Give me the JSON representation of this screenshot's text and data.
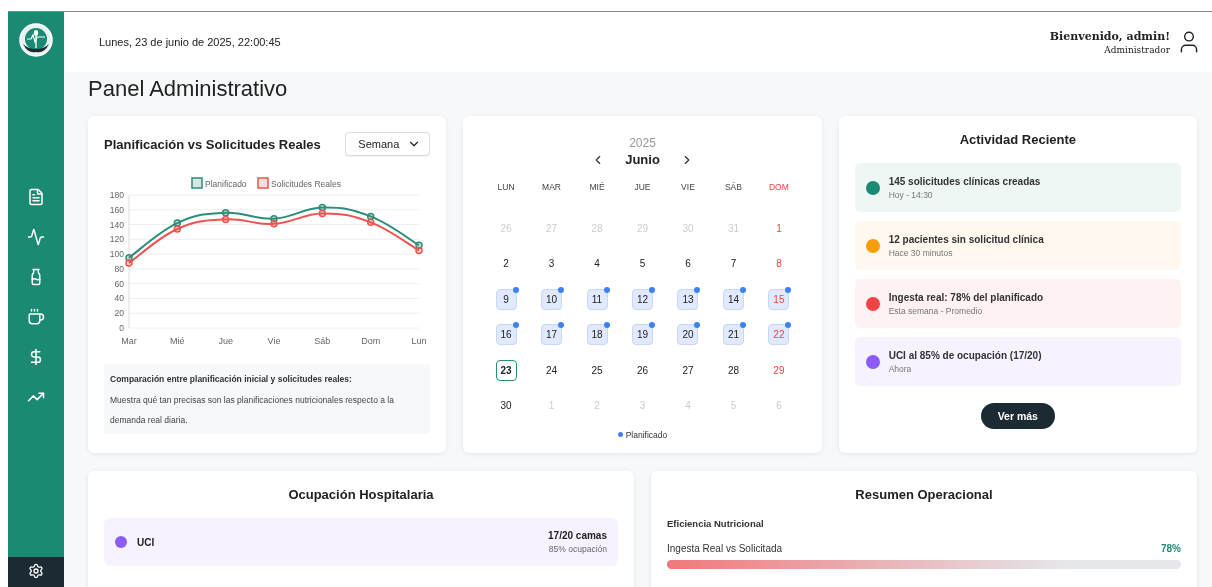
{
  "header": {
    "datetime": "Lunes, 23 de junio de 2025, 22:00:45",
    "greeting": "Bienvenido, admin!",
    "role": "Administrador"
  },
  "page_title": "Panel Administrativo",
  "planning_card": {
    "title": "Planificación vs Solicitudes Reales",
    "period": "Semana",
    "chart_data": {
      "type": "line",
      "grid": true,
      "legend": "top",
      "categories": [
        "Mar",
        "Mié",
        "Jue",
        "Vie",
        "Sáb",
        "Dom",
        "Lun"
      ],
      "ylim": [
        0,
        180
      ],
      "yticks": [
        0,
        20,
        40,
        60,
        80,
        100,
        120,
        140,
        160,
        180
      ],
      "series": [
        {
          "name": "Planificado",
          "color": "#2a8f78",
          "marker": "circle",
          "values": [
            95,
            142,
            156,
            148,
            163,
            151,
            112
          ]
        },
        {
          "name": "Solicitudes Reales",
          "color": "#ef5350",
          "marker": "circle",
          "values": [
            88,
            134,
            147,
            141,
            155,
            143,
            105
          ]
        }
      ]
    },
    "note_title": "Comparación entre planificación inicial y solicitudes reales:",
    "note_text": "Muestra qué tan precisas son las planificaciones nutricionales respecto a la demanda real diaria."
  },
  "calendar": {
    "year": "2025",
    "month": "Junio",
    "weekdays": [
      {
        "label": "LUN",
        "sunday": false
      },
      {
        "label": "MAR",
        "sunday": false
      },
      {
        "label": "MIÉ",
        "sunday": false
      },
      {
        "label": "JUE",
        "sunday": false
      },
      {
        "label": "VIE",
        "sunday": false
      },
      {
        "label": "SÁB",
        "sunday": false
      },
      {
        "label": "DOM",
        "sunday": true
      }
    ],
    "days": [
      {
        "day": "26",
        "outside": true,
        "sunday": false,
        "planned": false,
        "today": false
      },
      {
        "day": "27",
        "outside": true,
        "sunday": false,
        "planned": false,
        "today": false
      },
      {
        "day": "28",
        "outside": true,
        "sunday": false,
        "planned": false,
        "today": false
      },
      {
        "day": "29",
        "outside": true,
        "sunday": false,
        "planned": false,
        "today": false
      },
      {
        "day": "30",
        "outside": true,
        "sunday": false,
        "planned": false,
        "today": false
      },
      {
        "day": "31",
        "outside": true,
        "sunday": false,
        "planned": false,
        "today": false
      },
      {
        "day": "1",
        "outside": false,
        "sunday": true,
        "planned": false,
        "today": false
      },
      {
        "day": "2",
        "outside": false,
        "sunday": false,
        "planned": false,
        "today": false
      },
      {
        "day": "3",
        "outside": false,
        "sunday": false,
        "planned": false,
        "today": false
      },
      {
        "day": "4",
        "outside": false,
        "sunday": false,
        "planned": false,
        "today": false
      },
      {
        "day": "5",
        "outside": false,
        "sunday": false,
        "planned": false,
        "today": false
      },
      {
        "day": "6",
        "outside": false,
        "sunday": false,
        "planned": false,
        "today": false
      },
      {
        "day": "7",
        "outside": false,
        "sunday": false,
        "planned": false,
        "today": false
      },
      {
        "day": "8",
        "outside": false,
        "sunday": true,
        "planned": false,
        "today": false
      },
      {
        "day": "9",
        "outside": false,
        "sunday": false,
        "planned": true,
        "today": false
      },
      {
        "day": "10",
        "outside": false,
        "sunday": false,
        "planned": true,
        "today": false
      },
      {
        "day": "11",
        "outside": false,
        "sunday": false,
        "planned": true,
        "today": false
      },
      {
        "day": "12",
        "outside": false,
        "sunday": false,
        "planned": true,
        "today": false
      },
      {
        "day": "13",
        "outside": false,
        "sunday": false,
        "planned": true,
        "today": false
      },
      {
        "day": "14",
        "outside": false,
        "sunday": false,
        "planned": true,
        "today": false
      },
      {
        "day": "15",
        "outside": false,
        "sunday": true,
        "planned": true,
        "today": false
      },
      {
        "day": "16",
        "outside": false,
        "sunday": false,
        "planned": true,
        "today": false
      },
      {
        "day": "17",
        "outside": false,
        "sunday": false,
        "planned": true,
        "today": false
      },
      {
        "day": "18",
        "outside": false,
        "sunday": false,
        "planned": true,
        "today": false
      },
      {
        "day": "19",
        "outside": false,
        "sunday": false,
        "planned": true,
        "today": false
      },
      {
        "day": "20",
        "outside": false,
        "sunday": false,
        "planned": true,
        "today": false
      },
      {
        "day": "21",
        "outside": false,
        "sunday": false,
        "planned": true,
        "today": false
      },
      {
        "day": "22",
        "outside": false,
        "sunday": true,
        "planned": true,
        "today": false
      },
      {
        "day": "23",
        "outside": false,
        "sunday": false,
        "planned": false,
        "today": true
      },
      {
        "day": "24",
        "outside": false,
        "sunday": false,
        "planned": false,
        "today": false
      },
      {
        "day": "25",
        "outside": false,
        "sunday": false,
        "planned": false,
        "today": false
      },
      {
        "day": "26",
        "outside": false,
        "sunday": false,
        "planned": false,
        "today": false
      },
      {
        "day": "27",
        "outside": false,
        "sunday": false,
        "planned": false,
        "today": false
      },
      {
        "day": "28",
        "outside": false,
        "sunday": false,
        "planned": false,
        "today": false
      },
      {
        "day": "29",
        "outside": false,
        "sunday": true,
        "planned": false,
        "today": false
      },
      {
        "day": "30",
        "outside": false,
        "sunday": false,
        "planned": false,
        "today": false
      },
      {
        "day": "1",
        "outside": true,
        "sunday": false,
        "planned": false,
        "today": false
      },
      {
        "day": "2",
        "outside": true,
        "sunday": false,
        "planned": false,
        "today": false
      },
      {
        "day": "3",
        "outside": true,
        "sunday": false,
        "planned": false,
        "today": false
      },
      {
        "day": "4",
        "outside": true,
        "sunday": false,
        "planned": false,
        "today": false
      },
      {
        "day": "5",
        "outside": true,
        "sunday": false,
        "planned": false,
        "today": false
      },
      {
        "day": "6",
        "outside": true,
        "sunday": false,
        "planned": false,
        "today": false
      }
    ],
    "legend": "Planificado"
  },
  "activity": {
    "title": "Actividad Reciente",
    "items": [
      {
        "title": "145 solicitudes clínicas creadas",
        "time": "Hoy - 14:30",
        "color": "#1b8a72"
      },
      {
        "title": "12 pacientes sin solicitud clínica",
        "time": "Hace 30 minutos",
        "color": "#f59e0b"
      },
      {
        "title": "Ingesta real: 78% del planificado",
        "time": "Esta semana - Promedio",
        "color": "#ef4444"
      },
      {
        "title": "UCI al 85% de ocupación (17/20)",
        "time": "Ahora",
        "color": "#8b5cf6"
      }
    ],
    "button": "Ver más"
  },
  "occupancy": {
    "title": "Ocupación Hospitalaria",
    "units": [
      {
        "name": "UCI",
        "beds": "17/20 camas",
        "rate": "85% ocupación",
        "color": "#8b5cf6"
      }
    ]
  },
  "summary": {
    "title": "Resumen Operacional",
    "section": "Eficiencia Nutricional",
    "metrics": [
      {
        "label": "Ingesta Real vs Solicitada",
        "value": "78%",
        "level": 0.78
      }
    ]
  }
}
